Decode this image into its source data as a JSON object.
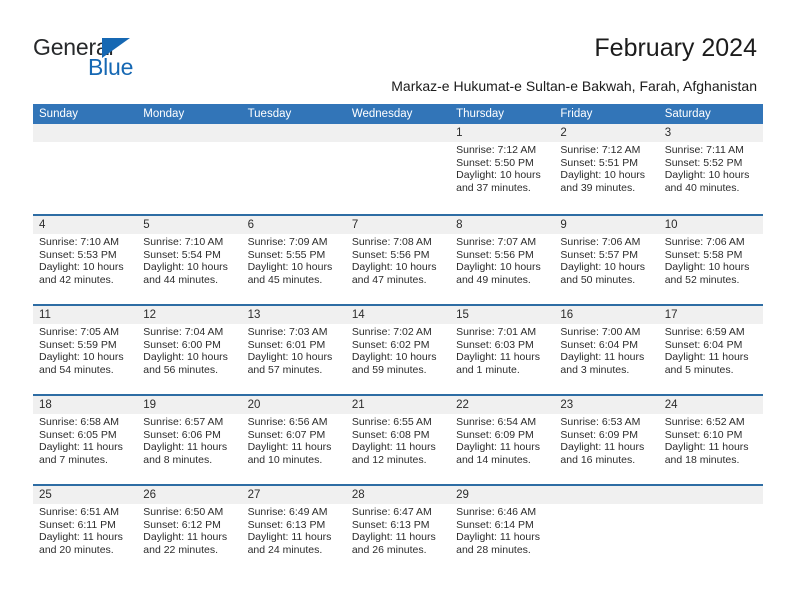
{
  "brand": {
    "name_part1": "General",
    "name_part2": "Blue",
    "accent_color": "#1668b3"
  },
  "header": {
    "title": "February 2024",
    "subtitle": "Markaz-e Hukumat-e Sultan-e Bakwah, Farah, Afghanistan"
  },
  "calendar": {
    "header_color": "#3275b8",
    "band_color": "#f0f0f0",
    "separator_color": "#2e6da4",
    "weekdays": [
      "Sunday",
      "Monday",
      "Tuesday",
      "Wednesday",
      "Thursday",
      "Friday",
      "Saturday"
    ],
    "weeks": [
      [
        {
          "day": "",
          "sunrise": "",
          "sunset": "",
          "daylight": ""
        },
        {
          "day": "",
          "sunrise": "",
          "sunset": "",
          "daylight": ""
        },
        {
          "day": "",
          "sunrise": "",
          "sunset": "",
          "daylight": ""
        },
        {
          "day": "",
          "sunrise": "",
          "sunset": "",
          "daylight": ""
        },
        {
          "day": "1",
          "sunrise": "Sunrise: 7:12 AM",
          "sunset": "Sunset: 5:50 PM",
          "daylight": "Daylight: 10 hours and 37 minutes."
        },
        {
          "day": "2",
          "sunrise": "Sunrise: 7:12 AM",
          "sunset": "Sunset: 5:51 PM",
          "daylight": "Daylight: 10 hours and 39 minutes."
        },
        {
          "day": "3",
          "sunrise": "Sunrise: 7:11 AM",
          "sunset": "Sunset: 5:52 PM",
          "daylight": "Daylight: 10 hours and 40 minutes."
        }
      ],
      [
        {
          "day": "4",
          "sunrise": "Sunrise: 7:10 AM",
          "sunset": "Sunset: 5:53 PM",
          "daylight": "Daylight: 10 hours and 42 minutes."
        },
        {
          "day": "5",
          "sunrise": "Sunrise: 7:10 AM",
          "sunset": "Sunset: 5:54 PM",
          "daylight": "Daylight: 10 hours and 44 minutes."
        },
        {
          "day": "6",
          "sunrise": "Sunrise: 7:09 AM",
          "sunset": "Sunset: 5:55 PM",
          "daylight": "Daylight: 10 hours and 45 minutes."
        },
        {
          "day": "7",
          "sunrise": "Sunrise: 7:08 AM",
          "sunset": "Sunset: 5:56 PM",
          "daylight": "Daylight: 10 hours and 47 minutes."
        },
        {
          "day": "8",
          "sunrise": "Sunrise: 7:07 AM",
          "sunset": "Sunset: 5:56 PM",
          "daylight": "Daylight: 10 hours and 49 minutes."
        },
        {
          "day": "9",
          "sunrise": "Sunrise: 7:06 AM",
          "sunset": "Sunset: 5:57 PM",
          "daylight": "Daylight: 10 hours and 50 minutes."
        },
        {
          "day": "10",
          "sunrise": "Sunrise: 7:06 AM",
          "sunset": "Sunset: 5:58 PM",
          "daylight": "Daylight: 10 hours and 52 minutes."
        }
      ],
      [
        {
          "day": "11",
          "sunrise": "Sunrise: 7:05 AM",
          "sunset": "Sunset: 5:59 PM",
          "daylight": "Daylight: 10 hours and 54 minutes."
        },
        {
          "day": "12",
          "sunrise": "Sunrise: 7:04 AM",
          "sunset": "Sunset: 6:00 PM",
          "daylight": "Daylight: 10 hours and 56 minutes."
        },
        {
          "day": "13",
          "sunrise": "Sunrise: 7:03 AM",
          "sunset": "Sunset: 6:01 PM",
          "daylight": "Daylight: 10 hours and 57 minutes."
        },
        {
          "day": "14",
          "sunrise": "Sunrise: 7:02 AM",
          "sunset": "Sunset: 6:02 PM",
          "daylight": "Daylight: 10 hours and 59 minutes."
        },
        {
          "day": "15",
          "sunrise": "Sunrise: 7:01 AM",
          "sunset": "Sunset: 6:03 PM",
          "daylight": "Daylight: 11 hours and 1 minute."
        },
        {
          "day": "16",
          "sunrise": "Sunrise: 7:00 AM",
          "sunset": "Sunset: 6:04 PM",
          "daylight": "Daylight: 11 hours and 3 minutes."
        },
        {
          "day": "17",
          "sunrise": "Sunrise: 6:59 AM",
          "sunset": "Sunset: 6:04 PM",
          "daylight": "Daylight: 11 hours and 5 minutes."
        }
      ],
      [
        {
          "day": "18",
          "sunrise": "Sunrise: 6:58 AM",
          "sunset": "Sunset: 6:05 PM",
          "daylight": "Daylight: 11 hours and 7 minutes."
        },
        {
          "day": "19",
          "sunrise": "Sunrise: 6:57 AM",
          "sunset": "Sunset: 6:06 PM",
          "daylight": "Daylight: 11 hours and 8 minutes."
        },
        {
          "day": "20",
          "sunrise": "Sunrise: 6:56 AM",
          "sunset": "Sunset: 6:07 PM",
          "daylight": "Daylight: 11 hours and 10 minutes."
        },
        {
          "day": "21",
          "sunrise": "Sunrise: 6:55 AM",
          "sunset": "Sunset: 6:08 PM",
          "daylight": "Daylight: 11 hours and 12 minutes."
        },
        {
          "day": "22",
          "sunrise": "Sunrise: 6:54 AM",
          "sunset": "Sunset: 6:09 PM",
          "daylight": "Daylight: 11 hours and 14 minutes."
        },
        {
          "day": "23",
          "sunrise": "Sunrise: 6:53 AM",
          "sunset": "Sunset: 6:09 PM",
          "daylight": "Daylight: 11 hours and 16 minutes."
        },
        {
          "day": "24",
          "sunrise": "Sunrise: 6:52 AM",
          "sunset": "Sunset: 6:10 PM",
          "daylight": "Daylight: 11 hours and 18 minutes."
        }
      ],
      [
        {
          "day": "25",
          "sunrise": "Sunrise: 6:51 AM",
          "sunset": "Sunset: 6:11 PM",
          "daylight": "Daylight: 11 hours and 20 minutes."
        },
        {
          "day": "26",
          "sunrise": "Sunrise: 6:50 AM",
          "sunset": "Sunset: 6:12 PM",
          "daylight": "Daylight: 11 hours and 22 minutes."
        },
        {
          "day": "27",
          "sunrise": "Sunrise: 6:49 AM",
          "sunset": "Sunset: 6:13 PM",
          "daylight": "Daylight: 11 hours and 24 minutes."
        },
        {
          "day": "28",
          "sunrise": "Sunrise: 6:47 AM",
          "sunset": "Sunset: 6:13 PM",
          "daylight": "Daylight: 11 hours and 26 minutes."
        },
        {
          "day": "29",
          "sunrise": "Sunrise: 6:46 AM",
          "sunset": "Sunset: 6:14 PM",
          "daylight": "Daylight: 11 hours and 28 minutes."
        },
        {
          "day": "",
          "sunrise": "",
          "sunset": "",
          "daylight": ""
        },
        {
          "day": "",
          "sunrise": "",
          "sunset": "",
          "daylight": ""
        }
      ]
    ]
  }
}
